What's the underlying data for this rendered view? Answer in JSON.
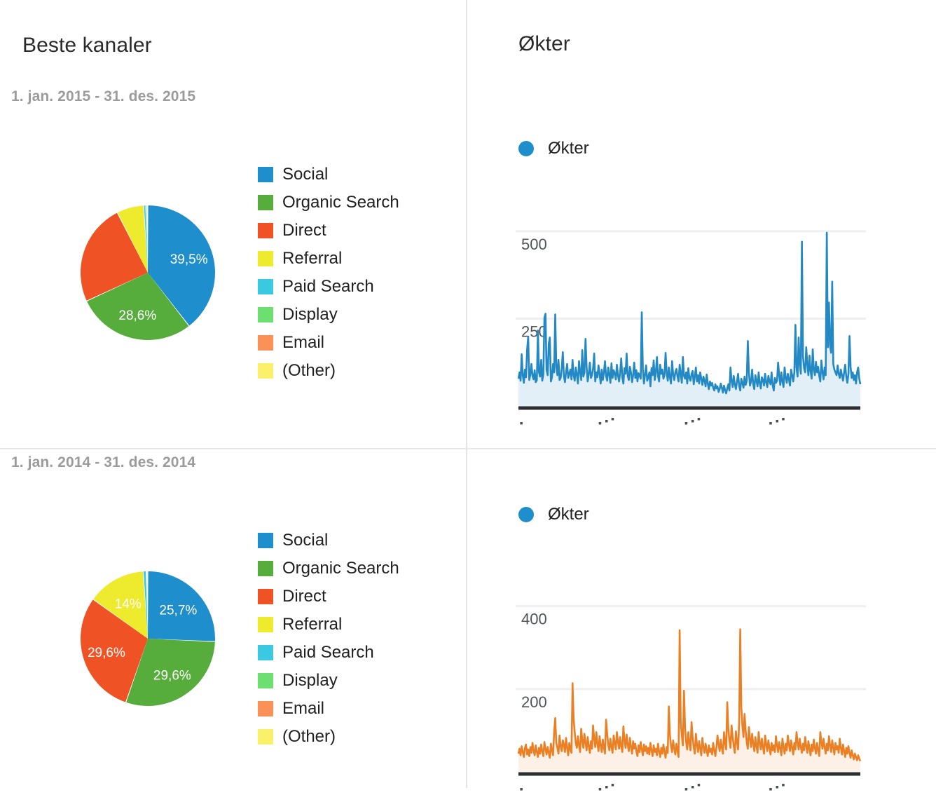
{
  "left_panel": {
    "title": "Beste kanaler",
    "sections": [
      {
        "date_range": "1. jan. 2015 - 31. des. 2015"
      },
      {
        "date_range": "1. jan. 2014 - 31. des. 2014"
      }
    ]
  },
  "right_panel": {
    "title": "Økter",
    "legend_label": "Økter",
    "legend_dot_color": "#1f8ecd"
  },
  "palette": {
    "social": "#1f8ecd",
    "organic_search": "#57ad3c",
    "direct": "#ef5225",
    "referral": "#eeea2e",
    "paid_search": "#3ac9e0",
    "display": "#6ddf71",
    "email": "#fa9257",
    "other": "#fbf06a",
    "line_2015": "#2389c4",
    "fill_2015": "#e3eff7",
    "line_2014": "#ea8023",
    "fill_2014": "#fdf0e6",
    "gridline": "#efefef",
    "axis": "#2b2d30",
    "divider": "#e5e5e5"
  },
  "chart_data": [
    {
      "id": "pie-2015",
      "type": "pie",
      "title": "Beste kanaler",
      "subtitle": "1. jan. 2015 - 31. des. 2015",
      "legend_position": "right",
      "labels": [
        "Social",
        "Organic Search",
        "Direct",
        "Referral",
        "Paid Search",
        "Display",
        "Email",
        "(Other)"
      ],
      "values": [
        39.5,
        28.6,
        24.4,
        6.5,
        0.5,
        0.3,
        0.1,
        0.1
      ],
      "value_unit": "%",
      "displayed_labels": [
        "39,5%",
        "28,6%",
        "",
        "",
        "",
        "",
        "",
        ""
      ],
      "colors": [
        "#1f8ecd",
        "#57ad3c",
        "#ef5225",
        "#eeea2e",
        "#3ac9e0",
        "#6ddf71",
        "#fa9257",
        "#fbf06a"
      ]
    },
    {
      "id": "timeseries-2015",
      "type": "area",
      "title": "Økter",
      "series_name": "Økter",
      "ylabel": "",
      "xlabel": "",
      "yticks": [
        250,
        500
      ],
      "ytick_labels": [
        "250",
        "500"
      ],
      "ylim": [
        0,
        560
      ],
      "grid": true,
      "color": "#2389c4",
      "fill": "#e3eff7",
      "x_axis_labels_clipped": true,
      "values": [
        78,
        96,
        72,
        148,
        88,
        66,
        104,
        82,
        160,
        198,
        74,
        90,
        120,
        86,
        76,
        102,
        68,
        74,
        216,
        96,
        84,
        132,
        72,
        90,
        252,
        264,
        104,
        88,
        178,
        196,
        70,
        82,
        120,
        96,
        262,
        112,
        88,
        132,
        74,
        80,
        108,
        154,
        86,
        68,
        96,
        120,
        80,
        92,
        104,
        76,
        132,
        88,
        72,
        110,
        90,
        64,
        128,
        98,
        74,
        160,
        84,
        96,
        192,
        112,
        70,
        92,
        124,
        80,
        88,
        108,
        150,
        70,
        96,
        82,
        116,
        92,
        64,
        104,
        74,
        96,
        128,
        86,
        72,
        110,
        90,
        66,
        122,
        80,
        102,
        94,
        76,
        118,
        88,
        70,
        96,
        136,
        82,
        64,
        108,
        92,
        150,
        86,
        74,
        112,
        96,
        68,
        88,
        124,
        80,
        102,
        70,
        94,
        86,
        78,
        268,
        104,
        64,
        90,
        116,
        72,
        82,
        96,
        56,
        108,
        88,
        130,
        74,
        96,
        140,
        86,
        70,
        118,
        92,
        104,
        78,
        88,
        152,
        96,
        72,
        110,
        82,
        64,
        128,
        90,
        74,
        96,
        106,
        84,
        70,
        118,
        92,
        66,
        140,
        86,
        78,
        96,
        64,
        108,
        80,
        72,
        92,
        100,
        62,
        84,
        110,
        70,
        88,
        64,
        96,
        78,
        60,
        84,
        72,
        56,
        90,
        64,
        48,
        70,
        58,
        66,
        52,
        44,
        62,
        50,
        56,
        40,
        48,
        64,
        52,
        38,
        58,
        46,
        36,
        50,
        62,
        44,
        110,
        72,
        54,
        86,
        62,
        48,
        70,
        92,
        58,
        44,
        78,
        66,
        52,
        84,
        60,
        72,
        186,
        96,
        58,
        70,
        104,
        62,
        48,
        88,
        72,
        56,
        96,
        66,
        50,
        82,
        74,
        58,
        92,
        68,
        54,
        86,
        70,
        62,
        96,
        58,
        44,
        80,
        66,
        72,
        124,
        88,
        60,
        96,
        70,
        54,
        110,
        82,
        66,
        92,
        76,
        58,
        104,
        88,
        70,
        96,
        232,
        110,
        84,
        196,
        120,
        92,
        470,
        142,
        108,
        96,
        168,
        120,
        88,
        144,
        100,
        78,
        162,
        104,
        88,
        126,
        96,
        112,
        86,
        70,
        130,
        98,
        76,
        110,
        88,
        496,
        168,
        296,
        172,
        152,
        356,
        120,
        104,
        96,
        88,
        116,
        92,
        80,
        104,
        88,
        72,
        96,
        118,
        84,
        66,
        92,
        200,
        112,
        80,
        96,
        74,
        88,
        64,
        96,
        110,
        78,
        62
      ]
    },
    {
      "id": "pie-2014",
      "type": "pie",
      "title": "Beste kanaler",
      "subtitle": "1. jan. 2014 - 31. des. 2014",
      "legend_position": "right",
      "labels": [
        "Social",
        "Organic Search",
        "Direct",
        "Referral",
        "Paid Search",
        "Display",
        "Email",
        "(Other)"
      ],
      "values": [
        25.7,
        29.6,
        29.6,
        14.0,
        0.7,
        0.2,
        0.1,
        0.1
      ],
      "value_unit": "%",
      "displayed_labels": [
        "25,7%",
        "29,6%",
        "29,6%",
        "14%",
        "",
        "",
        "",
        ""
      ],
      "colors": [
        "#1f8ecd",
        "#57ad3c",
        "#ef5225",
        "#eeea2e",
        "#3ac9e0",
        "#6ddf71",
        "#fa9257",
        "#fbf06a"
      ]
    },
    {
      "id": "timeseries-2014",
      "type": "area",
      "title": "Økter",
      "series_name": "Økter",
      "ylabel": "",
      "xlabel": "",
      "yticks": [
        200,
        400
      ],
      "ytick_labels": [
        "200",
        "400"
      ],
      "ylim": [
        0,
        440
      ],
      "grid": true,
      "color": "#ea8023",
      "fill": "#fdf0e6",
      "x_axis_labels_clipped": true,
      "values": [
        44,
        56,
        40,
        62,
        48,
        36,
        58,
        66,
        42,
        54,
        38,
        60,
        46,
        70,
        52,
        40,
        64,
        48,
        36,
        58,
        44,
        66,
        50,
        38,
        72,
        56,
        42,
        60,
        46,
        34,
        68,
        52,
        40,
        96,
        130,
        70,
        58,
        44,
        88,
        62,
        50,
        76,
        66,
        48,
        82,
        58,
        40,
        70,
        54,
        46,
        214,
        128,
        96,
        70,
        58,
        86,
        64,
        48,
        104,
        76,
        58,
        92,
        70,
        52,
        84,
        62,
        46,
        74,
        56,
        112,
        80,
        60,
        96,
        68,
        50,
        86,
        64,
        48,
        78,
        58,
        44,
        126,
        92,
        66,
        52,
        80,
        60,
        46,
        88,
        70,
        54,
        96,
        72,
        56,
        84,
        62,
        48,
        110,
        78,
        58,
        90,
        66,
        50,
        82,
        60,
        44,
        74,
        56,
        68,
        50,
        38,
        64,
        48,
        72,
        54,
        40,
        66,
        50,
        62,
        44,
        58,
        42,
        70,
        52,
        38,
        64,
        48,
        56,
        40,
        68,
        50,
        36,
        58,
        44,
        66,
        48,
        34,
        60,
        46,
        158,
        90,
        64,
        48,
        76,
        56,
        42,
        68,
        50,
        36,
        342,
        120,
        88,
        64,
        196,
        108,
        72,
        54,
        96,
        70,
        52,
        120,
        84,
        60,
        44,
        92,
        66,
        48,
        74,
        56,
        40,
        82,
        60,
        46,
        68,
        52,
        38,
        64,
        48,
        56,
        42,
        70,
        52,
        38,
        60,
        88,
        66,
        50,
        78,
        58,
        44,
        96,
        70,
        54,
        168,
        104,
        76,
        58,
        112,
        84,
        62,
        46,
        98,
        72,
        54,
        120,
        344,
        156,
        112,
        84,
        140,
        100,
        72,
        56,
        108,
        80,
        60,
        92,
        68,
        50,
        84,
        62,
        46,
        96,
        72,
        54,
        80,
        60,
        44,
        88,
        66,
        50,
        76,
        58,
        42,
        70,
        52,
        64,
        48,
        86,
        64,
        48,
        72,
        56,
        40,
        80,
        60,
        44,
        68,
        52,
        88,
        66,
        50,
        76,
        58,
        42,
        70,
        54,
        96,
        72,
        54,
        80,
        60,
        46,
        68,
        52,
        84,
        62,
        46,
        74,
        56,
        40,
        66,
        50,
        78,
        58,
        44,
        70,
        52,
        38,
        96,
        72,
        56,
        80,
        60,
        44,
        68,
        52,
        86,
        64,
        48,
        76,
        58,
        42,
        70,
        54,
        62,
        46,
        80,
        58,
        42,
        66,
        50,
        36,
        58,
        44,
        62,
        46,
        34,
        52,
        40,
        30,
        44,
        36,
        28,
        40,
        32,
        26
      ]
    }
  ]
}
